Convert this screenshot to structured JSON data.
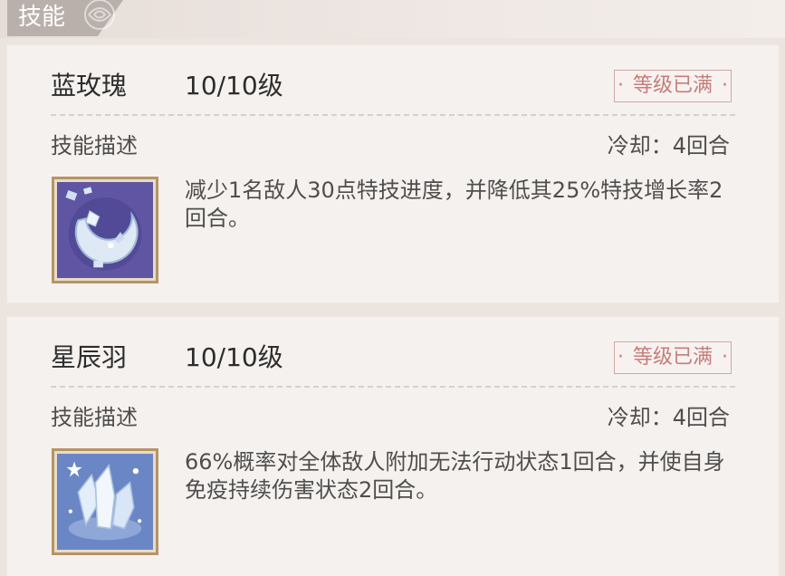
{
  "header": {
    "title": "技能"
  },
  "skills": [
    {
      "name": "蓝玫瑰",
      "level": "10/10级",
      "badge": "等级已满",
      "desc_label": "技能描述",
      "cooldown": "冷却：4回合",
      "description": "减少1名敌人30点特技进度，并降低其25%特技增长率2回合。",
      "icon": "blue-crescent-rose-icon"
    },
    {
      "name": "星辰羽",
      "level": "10/10级",
      "badge": "等级已满",
      "desc_label": "技能描述",
      "cooldown": "冷却：4回合",
      "description": "66%概率对全体敌人附加无法行动状态1回合，并使自身免疫持续伤害状态2回合。",
      "icon": "ice-crystal-icon"
    }
  ],
  "colors": {
    "badge": "#c27e7c",
    "icon_border": "#b69468",
    "header_tab": "#b9b0ab"
  }
}
